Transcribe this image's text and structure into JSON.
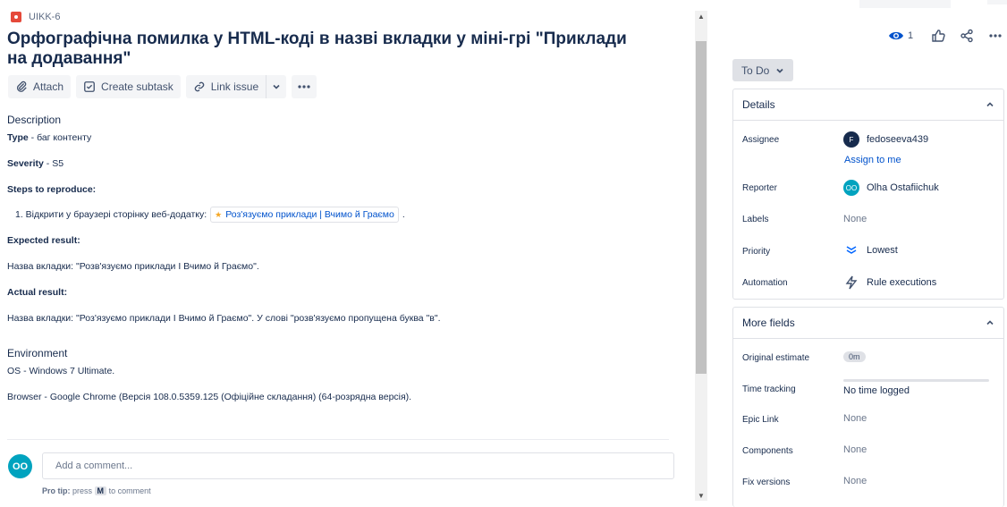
{
  "issue": {
    "key": "UIKK-6",
    "title": "Орфографічна помилка у HTML-коді в назві вкладки у міні-грі \"Приклади на додавання\""
  },
  "toolbar": {
    "attach": "Attach",
    "create_subtask": "Create subtask",
    "link_issue": "Link issue"
  },
  "description": {
    "heading": "Description",
    "type_label": "Type",
    "type_value": " - баг контенту",
    "severity_label": "Severity",
    "severity_value": " - S5",
    "steps_label": "Steps to reproduce:",
    "step1_prefix": "1. Відкрити у браузері сторінку веб-додатку:",
    "step1_link": "Роз'язуємо приклади | Вчимо й Граємо",
    "step1_suffix": ".",
    "expected_label": "Expected result:",
    "expected_text": "Назва вкладки: \"Розв'язуємо приклади I Вчимо й Граємо\".",
    "actual_label": "Actual result:",
    "actual_text": "Назва вкладки: \"Роз'язуємо приклади I Вчимо й Граємо\". У слові \"розв'язуємо пропущена буква \"в\".",
    "environment_heading": "Environment",
    "os": "OS - Windows 7 Ultimate.",
    "browser": "Browser - Google Chrome (Версія 108.0.5359.125 (Офіційне складання) (64-розрядна версія)."
  },
  "comment": {
    "avatar": "OO",
    "placeholder": "Add a comment...",
    "pro_tip_label": "Pro tip:",
    "pro_tip_press": "press",
    "pro_tip_key": "M",
    "pro_tip_suffix": "to comment"
  },
  "actions": {
    "watch_count": "1"
  },
  "status": {
    "label": "To Do"
  },
  "details": {
    "heading": "Details",
    "assignee_label": "Assignee",
    "assignee_initial": "F",
    "assignee_name": "fedoseeva439",
    "assign_to_me": "Assign to me",
    "reporter_label": "Reporter",
    "reporter_initials": "OO",
    "reporter_name": "Olha Ostafiichuk",
    "labels_label": "Labels",
    "labels_value": "None",
    "priority_label": "Priority",
    "priority_value": "Lowest",
    "automation_label": "Automation",
    "automation_value": "Rule executions"
  },
  "more_fields": {
    "heading": "More fields",
    "original_estimate_label": "Original estimate",
    "original_estimate_value": "0m",
    "time_tracking_label": "Time tracking",
    "time_tracking_value": "No time logged",
    "epic_link_label": "Epic Link",
    "epic_link_value": "None",
    "components_label": "Components",
    "components_value": "None",
    "fix_versions_label": "Fix versions",
    "fix_versions_value": "None"
  },
  "colors": {
    "accent": "#0052cc",
    "bug": "#e5493a",
    "avatar_teal": "#00a3bf"
  }
}
